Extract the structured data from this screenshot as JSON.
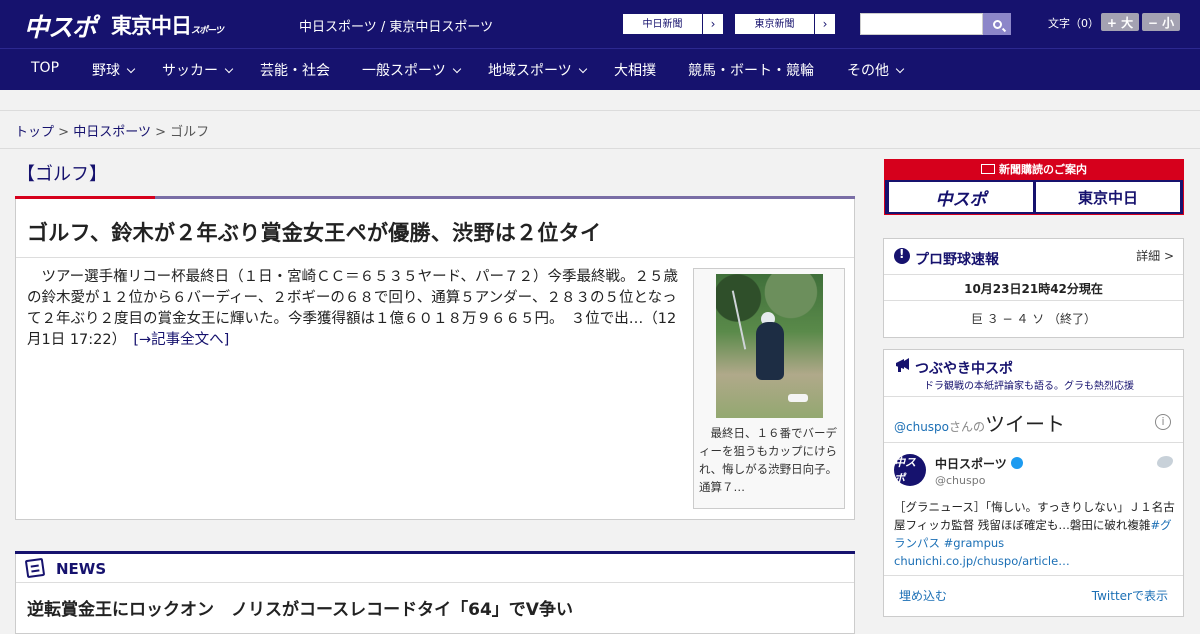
{
  "header": {
    "logo_chuspo": "中スポ",
    "logo_tokyo": "東京中日",
    "logo_tokyo_sub": "スポーツ",
    "site_name": "中日スポーツ / 東京中日スポーツ",
    "btn_chunichi": "中日新聞",
    "btn_tokyo": "東京新聞",
    "search_placeholder": "",
    "font_size_label": "文字（0）",
    "font_bigger": "+ 大",
    "font_smaller": "− 小"
  },
  "nav": {
    "items": [
      {
        "label": "TOP",
        "dropdown": false
      },
      {
        "label": "野球",
        "dropdown": true
      },
      {
        "label": "サッカー",
        "dropdown": true
      },
      {
        "label": "芸能・社会",
        "dropdown": false
      },
      {
        "label": "一般スポーツ",
        "dropdown": true
      },
      {
        "label": "地域スポーツ",
        "dropdown": true
      },
      {
        "label": "大相撲",
        "dropdown": false
      },
      {
        "label": "競馬・ボート・競輪",
        "dropdown": false
      },
      {
        "label": "その他",
        "dropdown": true
      }
    ]
  },
  "breadcrumb": {
    "top": "トップ",
    "sep1": ">",
    "parent": "中日スポーツ",
    "sep2": ">",
    "current": "ゴルフ"
  },
  "main": {
    "section_title": "【ゴルフ】",
    "headline": "ゴルフ、鈴木が２年ぶり賞金女王ペが優勝、渋野は２位タイ",
    "lead": "　ツアー選手権リコー杯最終日（１日・宮崎ＣＣ＝６５３５ヤード、パー７２）今季最終戦。２５歳の鈴木愛が１２位から６バーディー、２ボギーの６８で回り、通算５アンダー、２８３の５位となって２年ぶり２度目の賞金女王に輝いた。今季獲得額は１億６０１８万９６６５円。　３位で出…（12月1日 17:22）　",
    "more_link": "[→記事全文へ]",
    "photo_caption": "　最終日、１６番でバーディーを狙うもカップにけられ、悔しがる渋野日向子。通算７…",
    "news_label": "NEWS",
    "news_headline": "逆転賞金王にロックオン　ノリスがコースレコードタイ「64」でV争い"
  },
  "sidebar": {
    "subscription_caption": "新聞購読のご案内",
    "ad_chuspo": "中スポ",
    "ad_tokyo": "東京中日",
    "baseball": {
      "title": "プロ野球速報",
      "more": "詳細 >",
      "timestamp": "10月23日21時42分現在",
      "score": "巨 ３ − ４ ソ （終了）"
    },
    "twitter": {
      "title": "つぶやき中スポ",
      "subtitle": "ドラ観戦の本紙評論家も語る。グラも熱烈応援",
      "handle_prefix": "@chuspo",
      "handle_suffix": "さんの",
      "tweet_word": "ツイート",
      "info": "i",
      "avatar_text": "中スポ",
      "account_name": "中日スポーツ",
      "account_handle": "@chuspo",
      "tweet_text": "［グラニュース］「悔しい。すっきりしない」Ｊ１名古屋フィッカ監督 残留ほぼ確定も…磐田に破れ複雑",
      "tweet_tags": "#グランパス #grampus",
      "tweet_link": "chunichi.co.jp/chuspo/article…",
      "embed": "埋め込む",
      "view_on_twitter": "Twitterで表示"
    }
  }
}
